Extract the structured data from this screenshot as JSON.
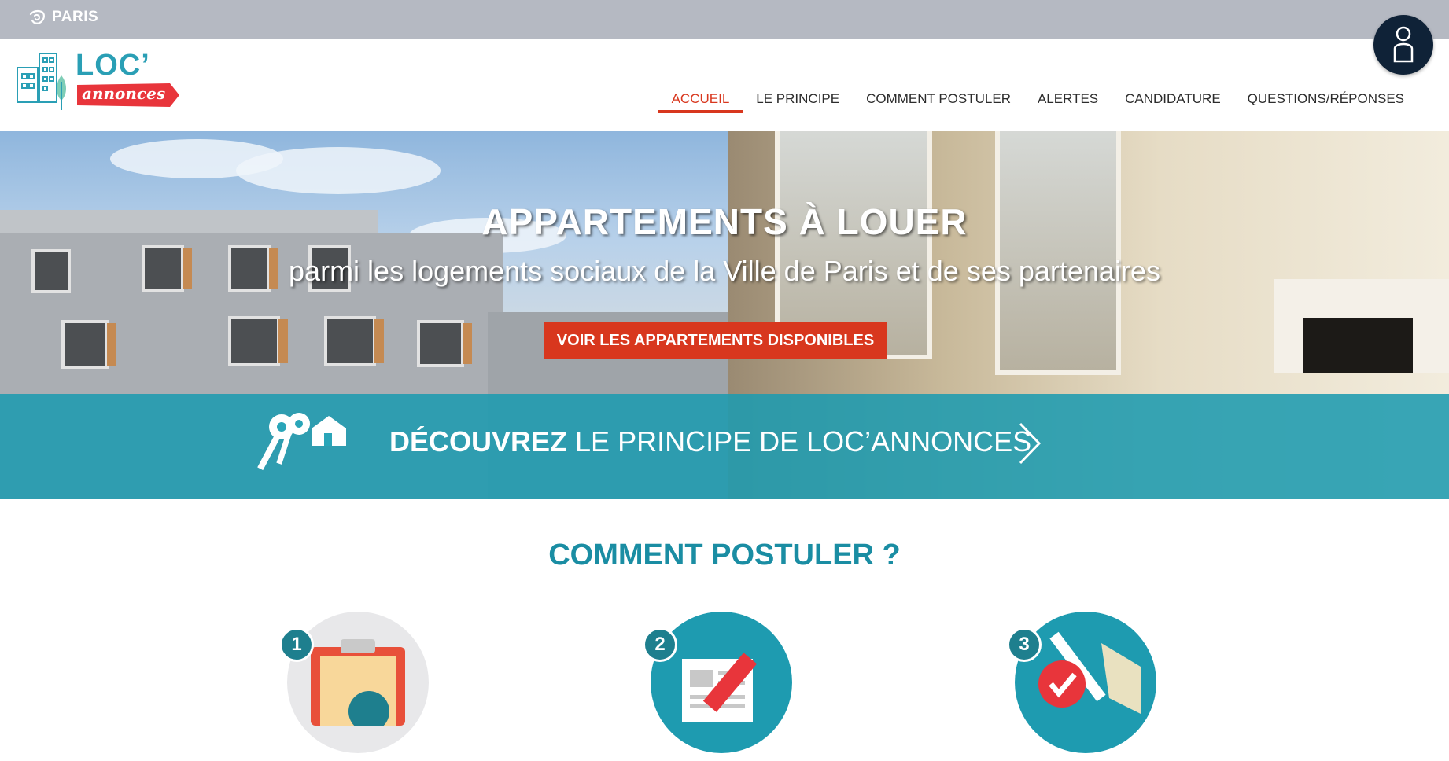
{
  "topbar": {
    "brand": "PARIS"
  },
  "logo": {
    "line1": "LOC’",
    "line2": "annonces"
  },
  "nav": {
    "items": [
      {
        "label": "ACCUEIL",
        "active": true
      },
      {
        "label": "LE PRINCIPE",
        "active": false
      },
      {
        "label": "COMMENT POSTULER",
        "active": false
      },
      {
        "label": "ALERTES",
        "active": false
      },
      {
        "label": "CANDIDATURE",
        "active": false
      },
      {
        "label": "QUESTIONS/RÉPONSES",
        "active": false
      }
    ]
  },
  "hero": {
    "title": "APPARTEMENTS À LOUER",
    "subtitle": "parmi les logements sociaux de la Ville de Paris et de ses partenaires",
    "cta": "VOIR LES APPARTEMENTS DISPONIBLES"
  },
  "banner": {
    "bold": "DÉCOUVREZ",
    "rest": " LE PRINCIPE DE LOC’ANNONCES"
  },
  "how": {
    "title_regular": "COMMENT ",
    "title_bold": "POSTULER ?",
    "steps": [
      "1",
      "2",
      "3"
    ]
  },
  "colors": {
    "accent": "#d8371e",
    "teal": "#2a9fb5",
    "topbar": "#b5b9c2",
    "user_button": "#0f2237"
  },
  "icons": [
    "paris-logo-icon",
    "keys-icon",
    "chevron-right-icon",
    "user-icon",
    "clipboard-icon",
    "form-pencil-icon",
    "map-check-icon"
  ]
}
